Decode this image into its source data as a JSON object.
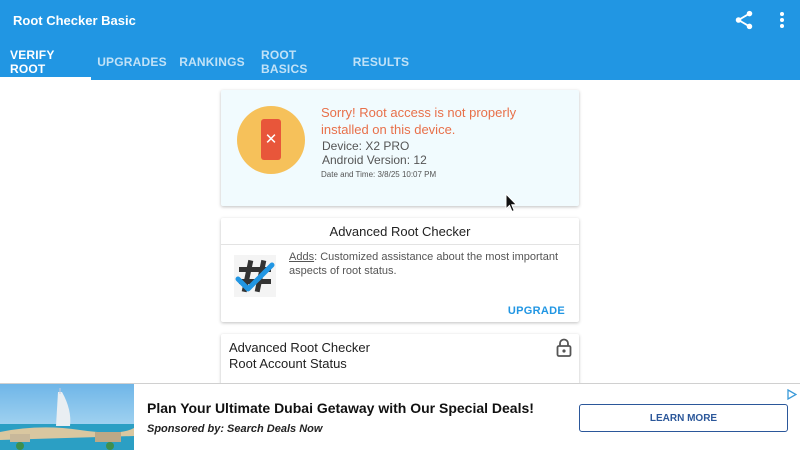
{
  "app": {
    "title": "Root Checker Basic"
  },
  "tabs": [
    {
      "label": "VERIFY ROOT",
      "active": true
    },
    {
      "label": "UPGRADES",
      "active": false
    },
    {
      "label": "RANKINGS",
      "active": false
    },
    {
      "label": "ROOT BASICS",
      "active": false
    },
    {
      "label": "RESULTS",
      "active": false
    }
  ],
  "icons": {
    "share": "share-icon",
    "menu": "more-vert-icon",
    "phone": "phone-x-icon",
    "app_logo": "root-checker-logo-icon",
    "lock": "lock-icon",
    "adchoices": "adchoices-icon"
  },
  "status": {
    "message": "Sorry! Root access is not properly installed on this device.",
    "device": "Device: X2 PRO",
    "android_version": "Android Version: 12",
    "date_time": "Date and Time: 3/8/25 10:07 PM"
  },
  "advanced": {
    "title": "Advanced Root Checker",
    "adds_label": "Adds",
    "adds_text": ": Customized assistance about the most important aspects of root status.",
    "upgrade_label": "UPGRADE"
  },
  "locked": {
    "line1": "Advanced Root Checker",
    "line2": "Root Account Status"
  },
  "ad": {
    "headline": "Plan Your Ultimate Dubai Getaway with Our Special Deals!",
    "sponsor": "Sponsored by: Search Deals Now",
    "cta": "LEARN MORE"
  },
  "colors": {
    "app_bar": "#2196e3",
    "status_bg": "#f1fbfe",
    "error_text": "#e8704a",
    "status_circle": "#f6c15a",
    "phone_red": "#e8563a",
    "cta_blue": "#2b579a"
  }
}
